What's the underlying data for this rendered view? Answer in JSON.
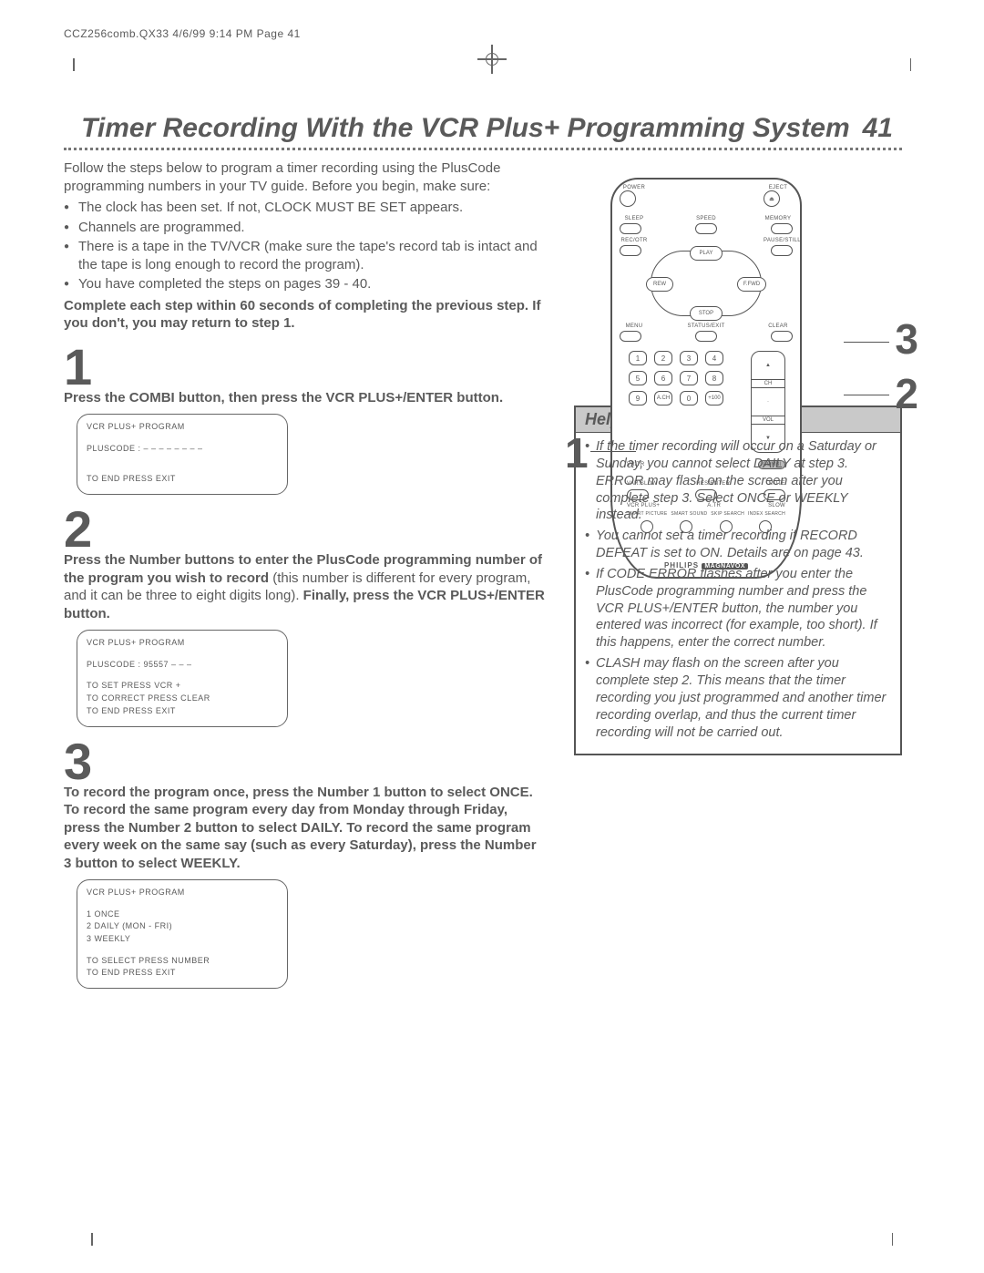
{
  "header_path": "CCZ256comb.QX33  4/6/99 9:14 PM  Page 41",
  "title": "Timer Recording With the VCR Plus+ Programming System",
  "page_number": "41",
  "intro_lead": "Follow the steps below to program a timer recording using the PlusCode programming numbers in your TV guide. Before you begin, make sure:",
  "intro_bullets": [
    "The clock has been set.  If not, CLOCK MUST BE SET appears.",
    "Channels are programmed.",
    "There is a tape in the TV/VCR (make sure the tape's record tab is intact and the tape is long enough to record the program).",
    "You have completed the steps on pages 39 - 40."
  ],
  "intro_bold": "Complete each step within 60 seconds of completing the previous step. If you don't, you may return to step 1.",
  "steps": [
    {
      "num": "1",
      "text_bold": "Press the COMBI button, then press the VCR PLUS+/ENTER button.",
      "text_tail": "",
      "screen": [
        "VCR PLUS+ PROGRAM",
        "",
        "PLUSCODE : – – – – – – – –",
        "",
        "",
        "TO END PRESS EXIT"
      ]
    },
    {
      "num": "2",
      "text_bold": "Press the Number buttons to enter the PlusCode programming number of the program you wish to record",
      "text_tail": " (this number is different for every program, and it can be three to eight digits long). ",
      "text_bold2": "Finally, press the VCR PLUS+/ENTER button.",
      "screen": [
        "VCR PLUS+ PROGRAM",
        "",
        "PLUSCODE :  95557 – – –",
        "",
        "TO SET PRESS VCR +",
        "TO CORRECT PRESS CLEAR",
        "TO END PRESS EXIT"
      ]
    },
    {
      "num": "3",
      "text_bold": "To record the program once, press the Number 1 button to select ONCE. To record the same program every day from Monday through Friday, press the Number 2 button to select DAILY. To record the same program every week on the same say (such as every Saturday), press the Number 3 button to select WEEKLY.",
      "text_tail": "",
      "screen": [
        "VCR PLUS+ PROGRAM",
        "",
        "1  ONCE",
        "2  DAILY (MON - FRI)",
        "3  WEEKLY",
        "",
        "TO SELECT PRESS NUMBER",
        "TO END PRESS EXIT"
      ]
    }
  ],
  "hints_title": "Helpful Hints",
  "hints": [
    "If the timer recording will occur on a Saturday or Sunday, you cannot select DAILY at step 3. ERROR may flash on the screen after you complete step 3. Select ONCE or WEEKLY instead.",
    "You cannot set a timer recording if RECORD DEFEAT is set to ON. Details are on page 43.",
    "If CODE ERROR flashes after you enter the PlusCode programming number and press the VCR PLUS+/ENTER button, the number you entered was incorrect (for example, too short). If this happens, enter the correct number.",
    "CLASH may flash on the screen after you complete step 2.  This means that the timer recording you just programmed and another timer recording overlap, and thus the current timer recording will not be carried out."
  ],
  "remote": {
    "top_labels": [
      "POWER",
      "",
      "EJECT"
    ],
    "row2": [
      "SLEEP",
      "SPEED",
      "MEMORY"
    ],
    "row3": [
      "REC/OTR",
      "",
      "PAUSE/STILL"
    ],
    "play_labels": {
      "play": "PLAY",
      "rew": "REW",
      "ffwd": "F.FWD",
      "stop": "STOP"
    },
    "row_menu": [
      "MENU",
      "STATUS/EXIT",
      "CLEAR"
    ],
    "numbers": [
      "1",
      "2",
      "3",
      "4",
      "5",
      "6",
      "7",
      "8",
      "9",
      "A.CH",
      "0",
      "+100"
    ],
    "chvol": {
      "ch": "CH",
      "vol": "VOL",
      "up": "▲",
      "down": "▼"
    },
    "combi_row": [
      "VR/TR",
      "",
      "COMBI"
    ],
    "row_vs": [
      "VAR.SLOW",
      "RES/ENTER",
      "MUTE"
    ],
    "row_vcr": [
      "VCR PLUS+",
      "",
      "A.TR",
      "SLOW"
    ],
    "bottom_labels": [
      "SMART PICTURE",
      "SMART SOUND",
      "SKIP SEARCH",
      "INDEX SEARCH"
    ],
    "brand1": "PHILIPS",
    "brand2": "MAGNAVOX"
  },
  "callouts": {
    "left": "1",
    "right_top": "3",
    "right_bottom": "2"
  }
}
